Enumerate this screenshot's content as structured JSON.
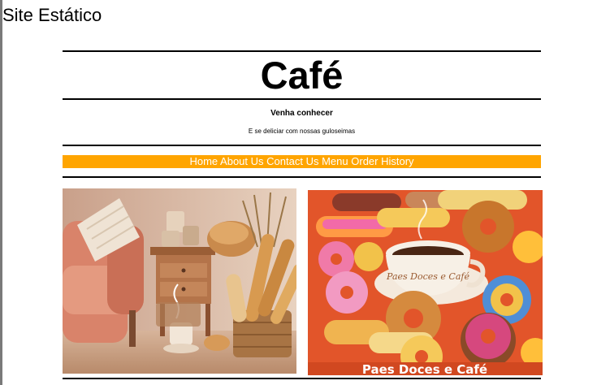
{
  "page": {
    "site_title": "Site Estático"
  },
  "header": {
    "title": "Café",
    "tagline": "Venha conhecer",
    "subtagline": "E se deliciar com nossas guloseimas"
  },
  "nav": {
    "items": [
      {
        "label": "Home"
      },
      {
        "label": "About Us"
      },
      {
        "label": "Contact Us"
      },
      {
        "label": "Menu"
      },
      {
        "label": "Order History"
      }
    ]
  },
  "images": {
    "cafe_interior": {
      "alt": "cafe-interior-image"
    },
    "donuts_poster": {
      "mug_text": "Paes Doces e Café",
      "banner_text": "Paes Doces e Café"
    }
  },
  "colors": {
    "nav_bg": "#ffa500",
    "nav_text": "#ffffff"
  }
}
